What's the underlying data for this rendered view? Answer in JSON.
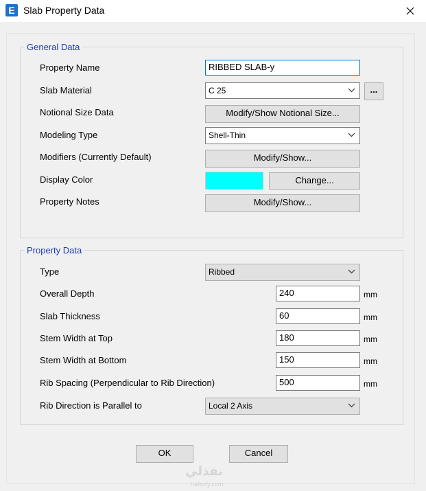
{
  "window": {
    "title": "Slab Property Data",
    "app_icon_letter": "E"
  },
  "general": {
    "legend": "General Data",
    "property_name_label": "Property Name",
    "property_name_value": "RIBBED SLAB-y",
    "slab_material_label": "Slab Material",
    "slab_material_value": "C 25",
    "material_more_label": "...",
    "notional_label": "Notional Size Data",
    "notional_button": "Modify/Show Notional Size...",
    "modeling_type_label": "Modeling Type",
    "modeling_type_value": "Shell-Thin",
    "modifiers_label": "Modifiers (Currently Default)",
    "modifiers_button": "Modify/Show...",
    "display_color_label": "Display Color",
    "display_color_value": "#00ffff",
    "change_button": "Change...",
    "notes_label": "Property Notes",
    "notes_button": "Modify/Show..."
  },
  "property": {
    "legend": "Property Data",
    "type_label": "Type",
    "type_value": "Ribbed",
    "overall_depth_label": "Overall Depth",
    "overall_depth_value": "240",
    "overall_depth_unit": "mm",
    "slab_thickness_label": "Slab Thickness",
    "slab_thickness_value": "60",
    "slab_thickness_unit": "mm",
    "stem_top_label": "Stem Width at Top",
    "stem_top_value": "180",
    "stem_top_unit": "mm",
    "stem_bottom_label": "Stem Width at Bottom",
    "stem_bottom_value": "150",
    "stem_bottom_unit": "mm",
    "rib_spacing_label": "Rib Spacing (Perpendicular to Rib Direction)",
    "rib_spacing_value": "500",
    "rib_spacing_unit": "mm",
    "rib_direction_label": "Rib Direction is Parallel to",
    "rib_direction_value": "Local 2 Axis"
  },
  "footer": {
    "ok_label": "OK",
    "cancel_label": "Cancel"
  },
  "watermark": {
    "text": "نفذلي",
    "sub": "nafezly.com"
  }
}
